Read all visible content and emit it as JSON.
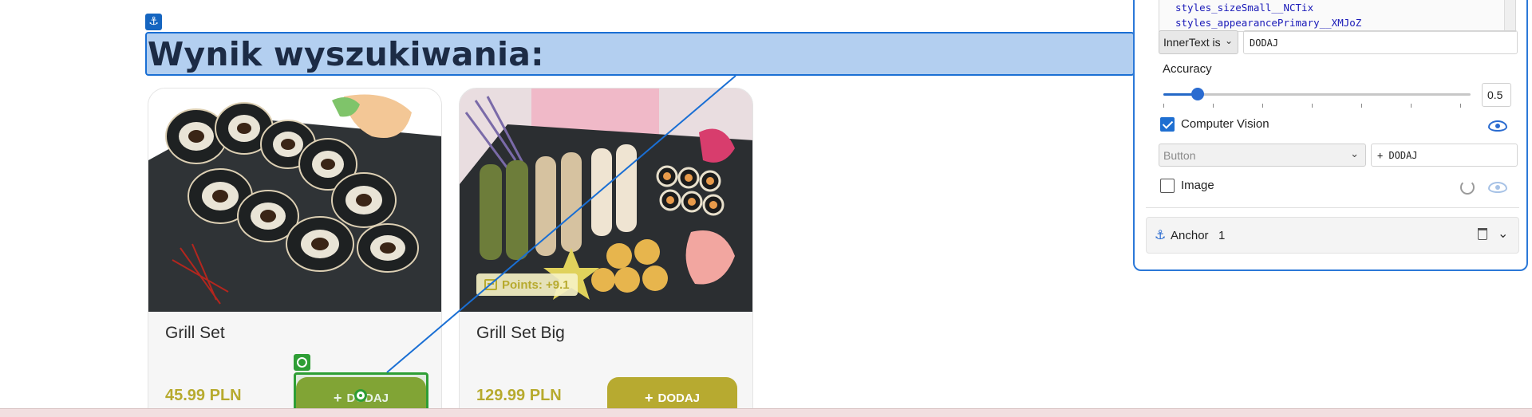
{
  "page": {
    "heading": "Wynik wyszukiwania:"
  },
  "products": [
    {
      "title": "Grill Set",
      "price": "45.99 PLN",
      "button_label": "DODAJ"
    },
    {
      "title": "Grill Set Big",
      "price": "129.99 PLN",
      "button_label": "DODAJ",
      "points_badge": "Points: +9.1"
    }
  ],
  "inspector": {
    "code_lines": [
      "styles_sizeSmall__NCTix",
      "styles_appearancePrimary__XMJoZ"
    ],
    "innertext_condition": "InnerText is",
    "innertext_value": "DODAJ",
    "accuracy_label": "Accuracy",
    "accuracy_value": "0.5",
    "computer_vision_label": "Computer Vision",
    "computer_vision_checked": true,
    "vision_type": "Button",
    "vision_text": "+ DODAJ",
    "image_label": "Image",
    "image_checked": false,
    "anchor_label": "Anchor",
    "anchor_count": "1"
  },
  "colors": {
    "accent_blue": "#2b78d8",
    "target_green": "#2e9e35",
    "price_gold": "#b7aa2e"
  },
  "icons": {
    "anchor": "anchor-icon",
    "target": "target-icon",
    "eye": "eye-icon",
    "refresh": "refresh-icon",
    "trash": "trash-icon",
    "chevron": "chevron-down-icon",
    "points": "points-icon"
  }
}
